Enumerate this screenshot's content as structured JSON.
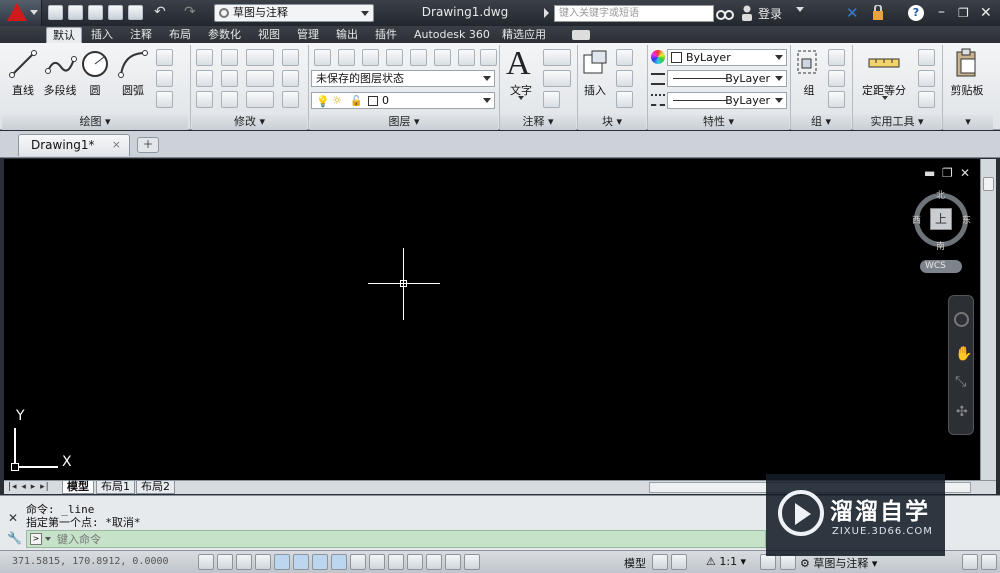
{
  "app": {
    "logo_letter": "A",
    "accent": "#d11a1a"
  },
  "title_bar": {
    "workspace": "草图与注释",
    "document_title": "Drawing1.dwg",
    "search_placeholder": "键入关键字或短语",
    "login_label": "登录"
  },
  "ribbon_tabs": [
    "默认",
    "插入",
    "注释",
    "布局",
    "参数化",
    "视图",
    "管理",
    "输出",
    "插件",
    "Autodesk 360",
    "精选应用"
  ],
  "active_tab": "默认",
  "panels": {
    "draw": {
      "title": "绘图",
      "line": "直线",
      "polyline": "多段线",
      "circle": "圆",
      "arc": "圆弧"
    },
    "modify": {
      "title": "修改"
    },
    "layers": {
      "title": "图层",
      "state": "未保存的图层状态",
      "current_layer": "0"
    },
    "annotation": {
      "title": "注释",
      "text": "文字"
    },
    "block": {
      "title": "块",
      "insert": "插入"
    },
    "properties": {
      "title": "特性",
      "color": "ByLayer",
      "linetype": "ByLayer",
      "lineweight": "ByLayer"
    },
    "groups": {
      "title": "组",
      "group": "组"
    },
    "utilities": {
      "title": "实用工具",
      "measure": "定距等分"
    },
    "clipboard": {
      "title": "剪贴板",
      "paste": "剪贴板"
    }
  },
  "document_tab": {
    "name": "Drawing1*",
    "close": "×",
    "new": "+"
  },
  "viewcube": {
    "north": "北",
    "south": "南",
    "east": "东",
    "west": "西",
    "top": "上",
    "wcs": "WCS"
  },
  "ucs": {
    "x": "X",
    "y": "Y"
  },
  "layout_tabs": [
    "模型",
    "布局1",
    "布局2"
  ],
  "command": {
    "history_1": "命令: _line",
    "history_2": "指定第一个点: *取消*",
    "prompt_placeholder": "键入命令"
  },
  "status": {
    "coords": "371.5815, 170.8912, 0.0000",
    "model_label": "模型",
    "scale": "1:1",
    "workspace": "草图与注释"
  },
  "watermark": {
    "name": "溜溜自学",
    "url": "ZIXUE.3D66.COM"
  }
}
